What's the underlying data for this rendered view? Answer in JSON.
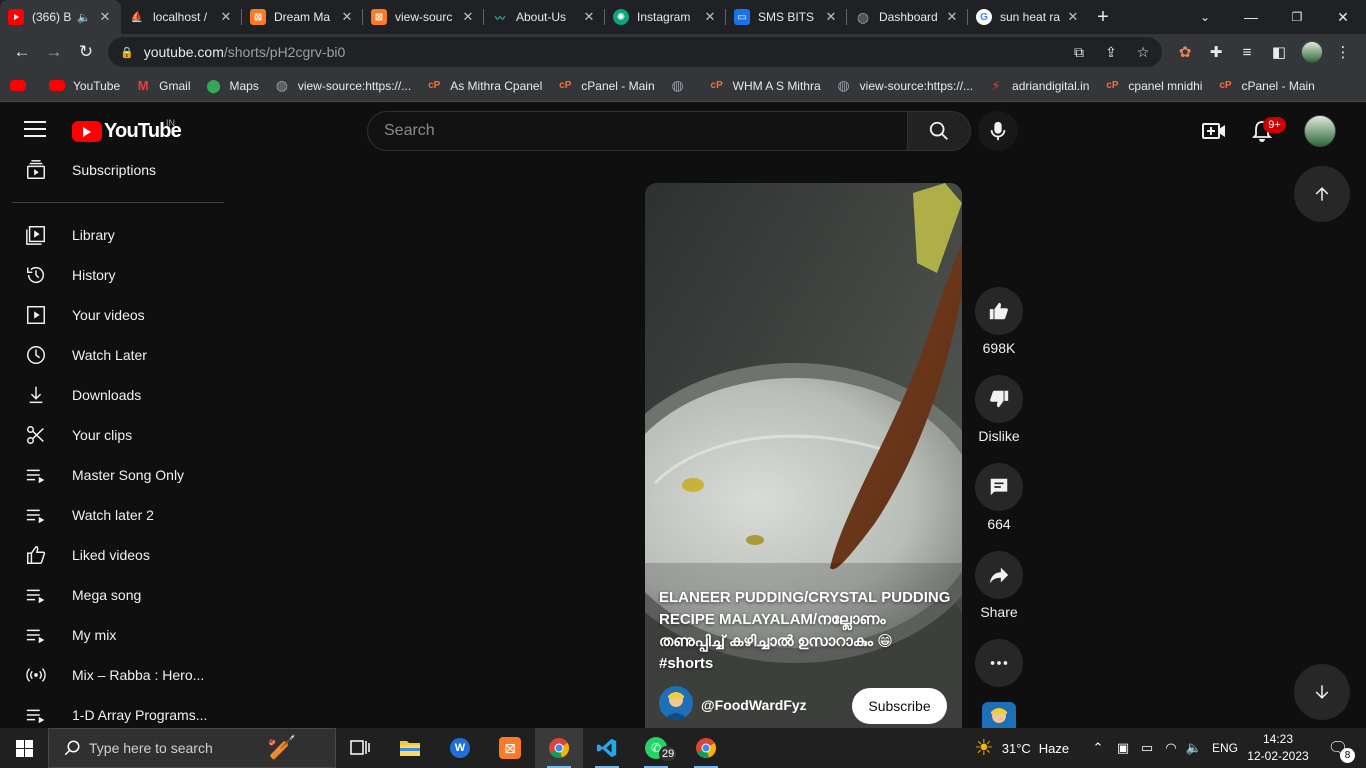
{
  "browser": {
    "tabs": [
      {
        "title": "(366) B",
        "favicon": "youtube-icon",
        "color": "#ff0000",
        "audio": true,
        "active": true
      },
      {
        "title": "localhost /",
        "favicon": "phpmyadmin-icon",
        "color": "#f0a030"
      },
      {
        "title": "Dream Ma",
        "favicon": "xampp-icon",
        "color": "#fb7a24"
      },
      {
        "title": "view-sourc",
        "favicon": "xampp-icon",
        "color": "#fb7a24"
      },
      {
        "title": "About-Us",
        "favicon": "site-icon",
        "color": "#2fb8a5"
      },
      {
        "title": "Instagram",
        "favicon": "chatgpt-icon",
        "color": "#10a37f"
      },
      {
        "title": "SMS BITS",
        "favicon": "sms-icon",
        "color": "#1a73e8"
      },
      {
        "title": "Dashboard",
        "favicon": "globe-icon",
        "color": "#9aa0a6"
      },
      {
        "title": "sun heat ra",
        "favicon": "google-icon",
        "color": "#4285f4"
      }
    ],
    "new_tab_glyph": "+",
    "url": {
      "host": "youtube.com",
      "path": "/shorts/pH2cgrv-bi0"
    },
    "bookmarks": [
      {
        "label": "",
        "icon": "youtube-icon",
        "color": "#ff0000"
      },
      {
        "label": "YouTube",
        "icon": "youtube-icon",
        "color": "#ff0000"
      },
      {
        "label": "Gmail",
        "icon": "gmail-icon",
        "color": "#ea4335"
      },
      {
        "label": "Maps",
        "icon": "maps-icon",
        "color": "#34a853"
      },
      {
        "label": "view-source:https://...",
        "icon": "globe-icon",
        "color": "#9aa0a6"
      },
      {
        "label": "As Mithra Cpanel",
        "icon": "cpanel-icon",
        "color": "#ff6c2c"
      },
      {
        "label": "cPanel - Main",
        "icon": "cpanel-icon",
        "color": "#ff6c2c"
      },
      {
        "label": "",
        "icon": "globe-icon",
        "color": "#9aa0a6"
      },
      {
        "label": "WHM A S Mithra",
        "icon": "cpanel-icon",
        "color": "#ff6c2c"
      },
      {
        "label": "view-source:https://...",
        "icon": "globe-icon",
        "color": "#9aa0a6"
      },
      {
        "label": "adriandigital.in",
        "icon": "site-icon",
        "color": "#e53935"
      },
      {
        "label": "cpanel mnidhi",
        "icon": "cpanel-icon",
        "color": "#ff6c2c"
      },
      {
        "label": "cPanel - Main",
        "icon": "cpanel-icon",
        "color": "#ff6c2c"
      }
    ]
  },
  "header": {
    "logo_text": "YouTube",
    "region": "IN",
    "search_placeholder": "Search",
    "notification_count": "9+"
  },
  "sidebar": {
    "subscriptions": "Subscriptions",
    "items": [
      {
        "label": "Library",
        "icon": "library-icon"
      },
      {
        "label": "History",
        "icon": "history-icon"
      },
      {
        "label": "Your videos",
        "icon": "your-videos-icon"
      },
      {
        "label": "Watch Later",
        "icon": "watch-later-icon"
      },
      {
        "label": "Downloads",
        "icon": "download-icon"
      },
      {
        "label": "Your clips",
        "icon": "scissors-icon"
      },
      {
        "label": "Master Song Only",
        "icon": "playlist-icon"
      },
      {
        "label": "Watch later 2",
        "icon": "playlist-icon"
      },
      {
        "label": "Liked videos",
        "icon": "like-icon"
      },
      {
        "label": "Mega song",
        "icon": "playlist-icon"
      },
      {
        "label": "My mix",
        "icon": "playlist-icon"
      },
      {
        "label": "Mix – Rabba : Hero...",
        "icon": "mix-icon"
      },
      {
        "label": "1-D Array Programs...",
        "icon": "playlist-icon"
      }
    ]
  },
  "short": {
    "title": "ELANEER PUDDING/CRYSTAL PUDDING RECIPE MALAYALAM/നല്ലോണം തണുപ്പിച്ച് കഴിച്ചാൽ ഉസാറാകും 😁",
    "tag": "#shorts",
    "channel": "@FoodWardFyz",
    "subscribe_label": "Subscribe",
    "likes": "698K",
    "dislike_label": "Dislike",
    "comments": "664",
    "share_label": "Share"
  },
  "taskbar": {
    "search_placeholder": "Type here to search",
    "whatsapp_badge": "29",
    "temperature": "31°C",
    "weather": "Haze",
    "language": "ENG",
    "time": "14:23",
    "date": "12-02-2023",
    "notification_count": "8"
  }
}
